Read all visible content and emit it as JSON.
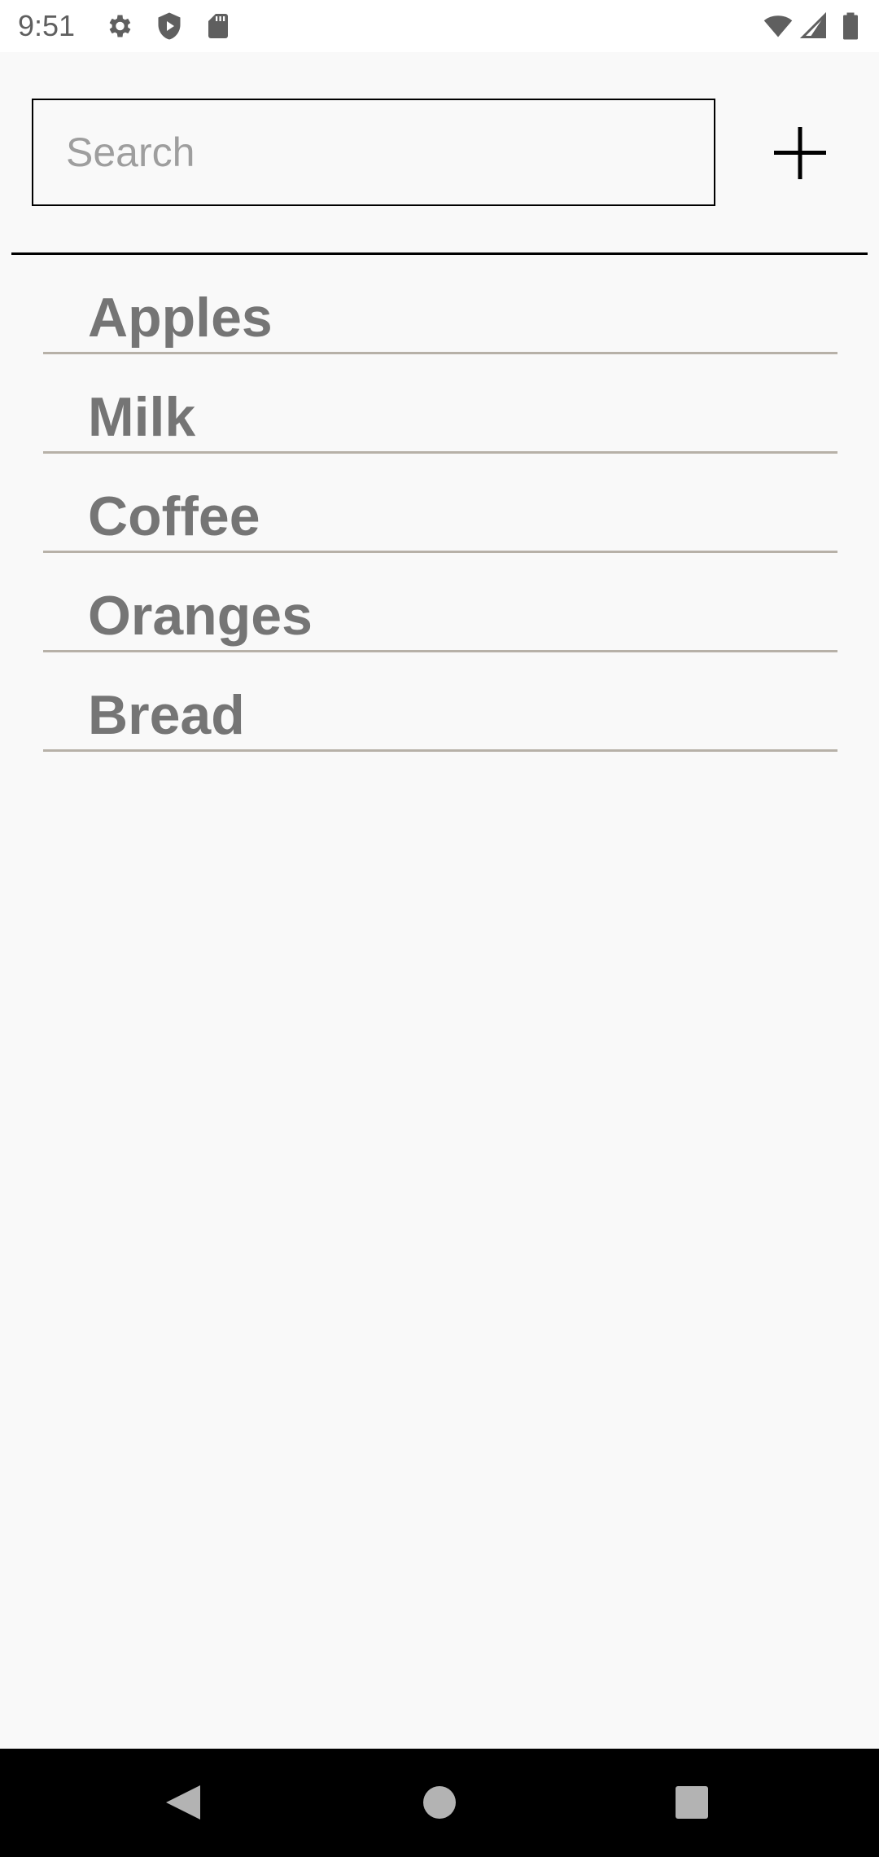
{
  "status_bar": {
    "time": "9:51",
    "left_icons": [
      "gear-icon",
      "shield-play-icon",
      "sd-card-icon"
    ],
    "right_icons": [
      "wifi-icon",
      "cell-signal-icon",
      "battery-icon"
    ]
  },
  "search": {
    "placeholder": "Search",
    "value": ""
  },
  "add_button": {
    "icon": "plus-icon"
  },
  "items": [
    {
      "label": "Apples"
    },
    {
      "label": "Milk"
    },
    {
      "label": "Coffee"
    },
    {
      "label": "Oranges"
    },
    {
      "label": "Bread"
    }
  ],
  "nav_bar": {
    "buttons": [
      "back-icon",
      "home-icon",
      "recents-icon"
    ]
  },
  "colors": {
    "background": "#f9f9f9",
    "item_text": "#757575",
    "item_rule": "#b7b1a8",
    "accent": "#000000"
  }
}
